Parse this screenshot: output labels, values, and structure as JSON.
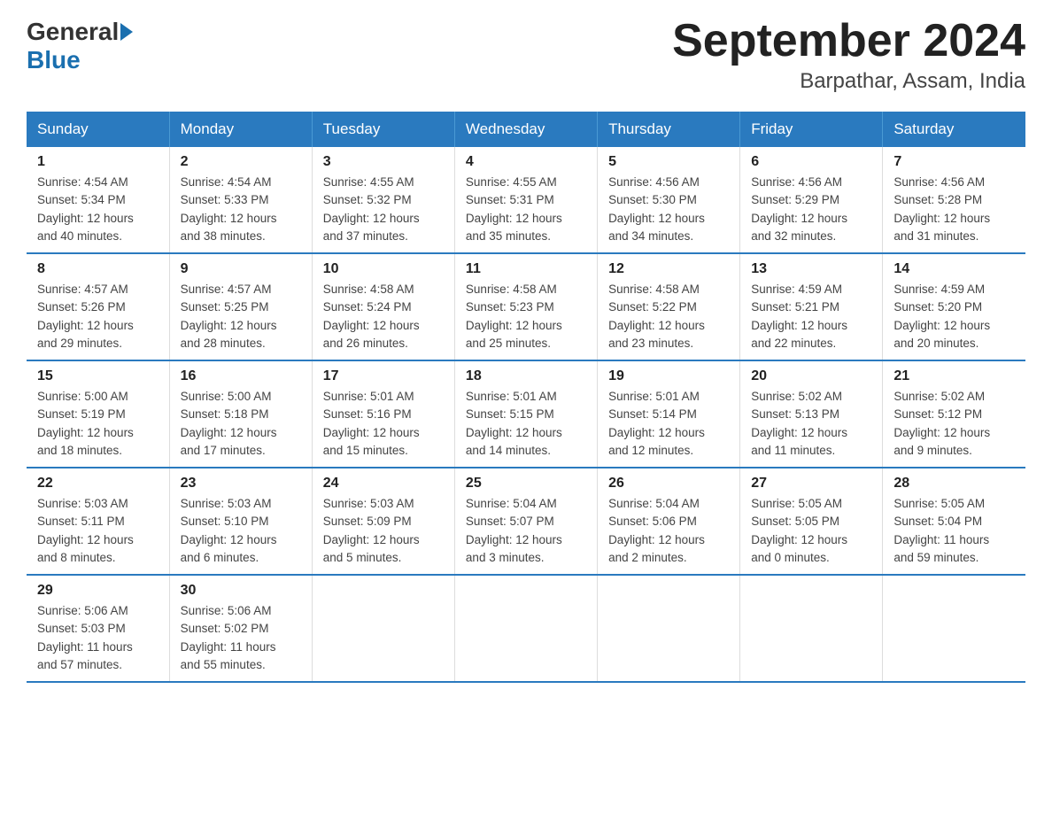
{
  "header": {
    "logo_general": "General",
    "logo_blue": "Blue",
    "month_title": "September 2024",
    "location": "Barpathar, Assam, India"
  },
  "days_of_week": [
    "Sunday",
    "Monday",
    "Tuesday",
    "Wednesday",
    "Thursday",
    "Friday",
    "Saturday"
  ],
  "weeks": [
    [
      {
        "day": "1",
        "sunrise": "4:54 AM",
        "sunset": "5:34 PM",
        "daylight": "12 hours and 40 minutes."
      },
      {
        "day": "2",
        "sunrise": "4:54 AM",
        "sunset": "5:33 PM",
        "daylight": "12 hours and 38 minutes."
      },
      {
        "day": "3",
        "sunrise": "4:55 AM",
        "sunset": "5:32 PM",
        "daylight": "12 hours and 37 minutes."
      },
      {
        "day": "4",
        "sunrise": "4:55 AM",
        "sunset": "5:31 PM",
        "daylight": "12 hours and 35 minutes."
      },
      {
        "day": "5",
        "sunrise": "4:56 AM",
        "sunset": "5:30 PM",
        "daylight": "12 hours and 34 minutes."
      },
      {
        "day": "6",
        "sunrise": "4:56 AM",
        "sunset": "5:29 PM",
        "daylight": "12 hours and 32 minutes."
      },
      {
        "day": "7",
        "sunrise": "4:56 AM",
        "sunset": "5:28 PM",
        "daylight": "12 hours and 31 minutes."
      }
    ],
    [
      {
        "day": "8",
        "sunrise": "4:57 AM",
        "sunset": "5:26 PM",
        "daylight": "12 hours and 29 minutes."
      },
      {
        "day": "9",
        "sunrise": "4:57 AM",
        "sunset": "5:25 PM",
        "daylight": "12 hours and 28 minutes."
      },
      {
        "day": "10",
        "sunrise": "4:58 AM",
        "sunset": "5:24 PM",
        "daylight": "12 hours and 26 minutes."
      },
      {
        "day": "11",
        "sunrise": "4:58 AM",
        "sunset": "5:23 PM",
        "daylight": "12 hours and 25 minutes."
      },
      {
        "day": "12",
        "sunrise": "4:58 AM",
        "sunset": "5:22 PM",
        "daylight": "12 hours and 23 minutes."
      },
      {
        "day": "13",
        "sunrise": "4:59 AM",
        "sunset": "5:21 PM",
        "daylight": "12 hours and 22 minutes."
      },
      {
        "day": "14",
        "sunrise": "4:59 AM",
        "sunset": "5:20 PM",
        "daylight": "12 hours and 20 minutes."
      }
    ],
    [
      {
        "day": "15",
        "sunrise": "5:00 AM",
        "sunset": "5:19 PM",
        "daylight": "12 hours and 18 minutes."
      },
      {
        "day": "16",
        "sunrise": "5:00 AM",
        "sunset": "5:18 PM",
        "daylight": "12 hours and 17 minutes."
      },
      {
        "day": "17",
        "sunrise": "5:01 AM",
        "sunset": "5:16 PM",
        "daylight": "12 hours and 15 minutes."
      },
      {
        "day": "18",
        "sunrise": "5:01 AM",
        "sunset": "5:15 PM",
        "daylight": "12 hours and 14 minutes."
      },
      {
        "day": "19",
        "sunrise": "5:01 AM",
        "sunset": "5:14 PM",
        "daylight": "12 hours and 12 minutes."
      },
      {
        "day": "20",
        "sunrise": "5:02 AM",
        "sunset": "5:13 PM",
        "daylight": "12 hours and 11 minutes."
      },
      {
        "day": "21",
        "sunrise": "5:02 AM",
        "sunset": "5:12 PM",
        "daylight": "12 hours and 9 minutes."
      }
    ],
    [
      {
        "day": "22",
        "sunrise": "5:03 AM",
        "sunset": "5:11 PM",
        "daylight": "12 hours and 8 minutes."
      },
      {
        "day": "23",
        "sunrise": "5:03 AM",
        "sunset": "5:10 PM",
        "daylight": "12 hours and 6 minutes."
      },
      {
        "day": "24",
        "sunrise": "5:03 AM",
        "sunset": "5:09 PM",
        "daylight": "12 hours and 5 minutes."
      },
      {
        "day": "25",
        "sunrise": "5:04 AM",
        "sunset": "5:07 PM",
        "daylight": "12 hours and 3 minutes."
      },
      {
        "day": "26",
        "sunrise": "5:04 AM",
        "sunset": "5:06 PM",
        "daylight": "12 hours and 2 minutes."
      },
      {
        "day": "27",
        "sunrise": "5:05 AM",
        "sunset": "5:05 PM",
        "daylight": "12 hours and 0 minutes."
      },
      {
        "day": "28",
        "sunrise": "5:05 AM",
        "sunset": "5:04 PM",
        "daylight": "11 hours and 59 minutes."
      }
    ],
    [
      {
        "day": "29",
        "sunrise": "5:06 AM",
        "sunset": "5:03 PM",
        "daylight": "11 hours and 57 minutes."
      },
      {
        "day": "30",
        "sunrise": "5:06 AM",
        "sunset": "5:02 PM",
        "daylight": "11 hours and 55 minutes."
      },
      null,
      null,
      null,
      null,
      null
    ]
  ],
  "labels": {
    "sunrise": "Sunrise:",
    "sunset": "Sunset:",
    "daylight": "Daylight:"
  }
}
